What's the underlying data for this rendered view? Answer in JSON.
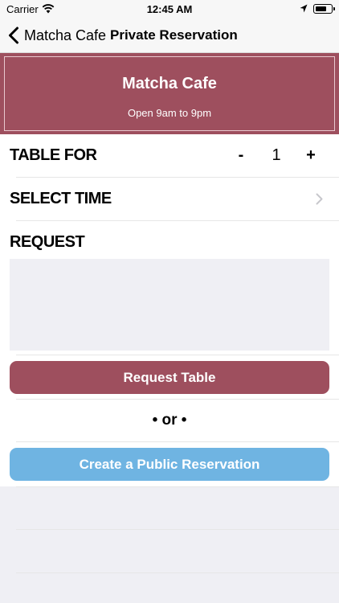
{
  "status_bar": {
    "carrier": "Carrier",
    "time": "12:45 AM"
  },
  "nav": {
    "back_label": "Matcha Cafe",
    "title": "Private Reservation"
  },
  "banner": {
    "name": "Matcha Cafe",
    "hours": "Open 9am to 9pm",
    "color": "#9e4f5e"
  },
  "table_for": {
    "label": "TABLE FOR",
    "minus": "-",
    "value": "1",
    "plus": "+"
  },
  "select_time": {
    "label": "SELECT TIME"
  },
  "request": {
    "label": "REQUEST",
    "value": ""
  },
  "buttons": {
    "request_table": "Request Table",
    "public_reservation": "Create a Public Reservation",
    "request_color": "#9e4f5e",
    "public_color": "#6fb4e2"
  },
  "divider": {
    "text": "• or •"
  }
}
